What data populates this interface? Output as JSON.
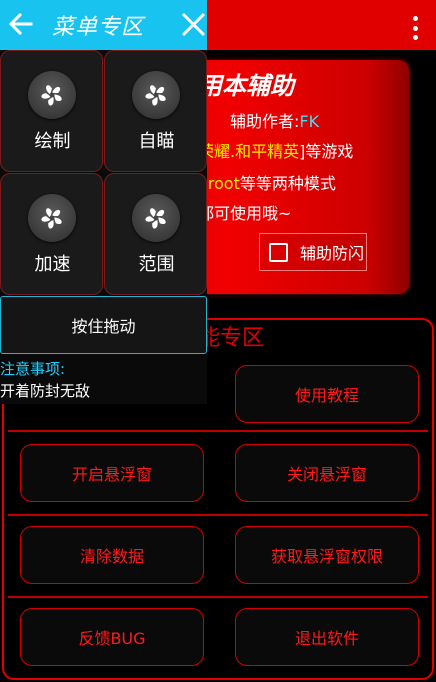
{
  "background_app": {
    "card": {
      "title": "用本辅助",
      "author_label": "辅助作者:",
      "author_value": "FK",
      "games_highlight": "荣耀.和平精英",
      "games_suffix": "]等游戏",
      "mode_highlight": "oroot",
      "mode_suffix": "等等两种模式",
      "all_text": "都可使用哦~",
      "checkbox_label": "辅助防闪",
      "checkbox_checked": false
    },
    "feature_panel": {
      "title": "能专区",
      "buttons": [
        "使用教程",
        "开启悬浮窗",
        "关闭悬浮窗",
        "清除数据",
        "获取悬浮窗权限",
        "反馈BUG",
        "退出软件"
      ]
    }
  },
  "menu": {
    "title": "菜单专区",
    "tiles": [
      "绘制",
      "自瞄",
      "加速",
      "范围"
    ],
    "drag_label": "按住拖动",
    "notice_title": "注意事项:",
    "notice_text": "开着防封无敌"
  },
  "colors": {
    "menu_header": "#19c3f0",
    "app_red": "#e00000",
    "author_accent": "#3fe0ff",
    "highlight_yellow": "#ffee00"
  },
  "icons": {
    "back": "arrow-left-icon",
    "close": "close-icon",
    "tile": "fan-icon",
    "overflow": "more-vertical-icon"
  }
}
